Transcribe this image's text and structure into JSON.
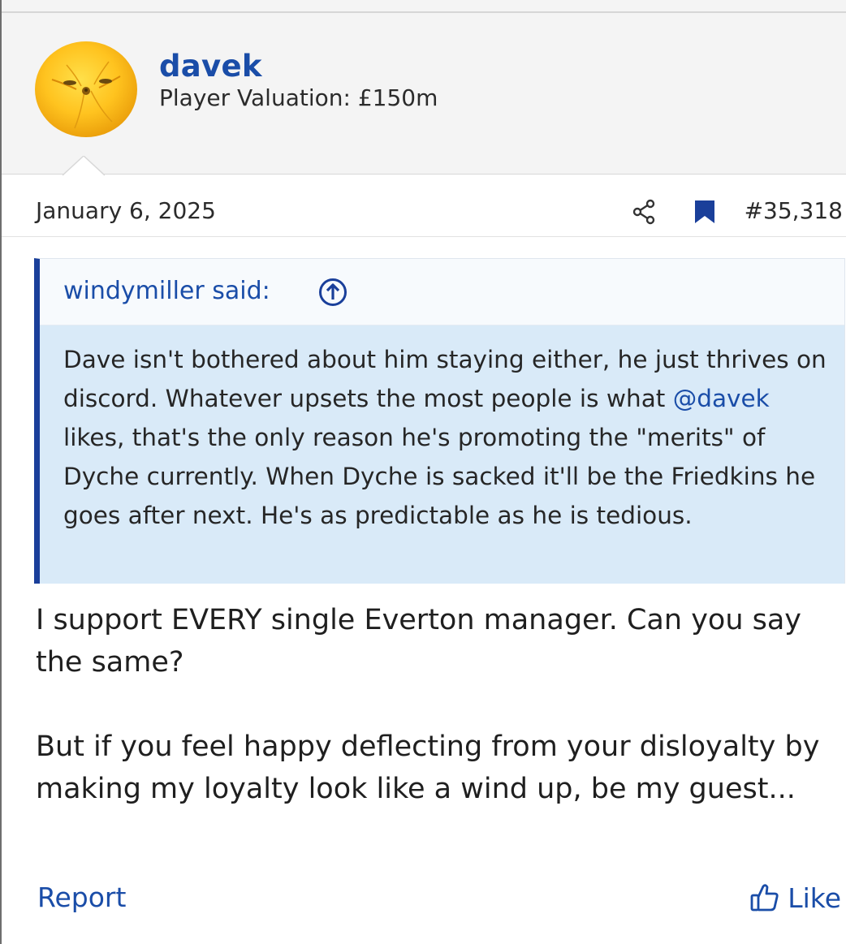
{
  "user": {
    "name": "davek",
    "title": "Player Valuation: £150m"
  },
  "post": {
    "date": "January 6, 2025",
    "number": "#35,318"
  },
  "quote": {
    "author": "windymiller said:",
    "text_before": "Dave isn't bothered about him staying either, he just thrives on discord. Whatever upsets the most people is what ",
    "mention": "@davek",
    "text_after": " likes, that's the only reason he's promoting the \"merits\" of Dyche currently. When Dyche is sacked it'll be the Friedkins he goes after next. He's as predictable as he is tedious."
  },
  "message": {
    "paragraphs": [
      "I support EVERY single Everton manager. Can you say the same?",
      "But if you feel happy deflecting from your disloyalty by making my loyalty look like a wind up, be my guest..."
    ]
  },
  "actions": {
    "report_label": "Report",
    "like_label": "Like"
  },
  "icons": {
    "share": "share-icon",
    "bookmark": "bookmark-icon",
    "quote_jump": "arrow-up-circle-icon",
    "like": "thumbs-up-icon"
  },
  "colors": {
    "link": "#1a4da8",
    "quote_border": "#1a3f9a",
    "quote_background": "#d9eaf8",
    "header_background": "#f4f4f4"
  }
}
